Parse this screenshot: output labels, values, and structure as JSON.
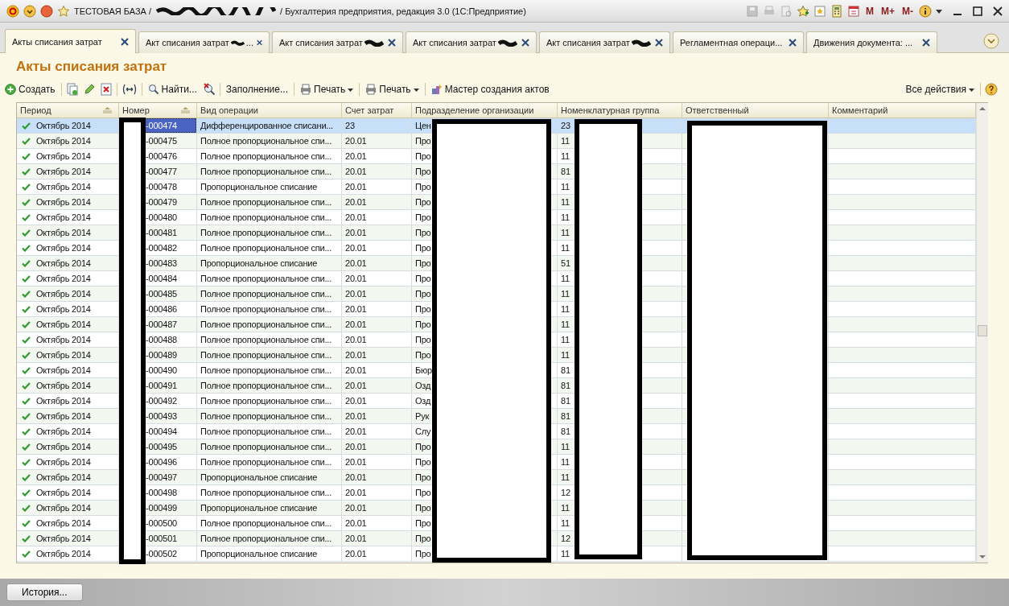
{
  "window": {
    "title_start": "ТЕСТОВАЯ БАЗА /",
    "title_end": "/ Бухгалтерия предприятия, редакция 3.0  (1С:Предприятие)",
    "memory_buttons": [
      "M",
      "M+",
      "M-"
    ]
  },
  "tabs": [
    {
      "label": "Акты списания затрат",
      "redacted": false,
      "selected": true
    },
    {
      "label": "Акт списания затрат",
      "redacted": true,
      "tail": "...",
      "selected": false
    },
    {
      "label": "Акт списания затрат",
      "redacted": true,
      "selected": false
    },
    {
      "label": "Акт списания затрат",
      "redacted": true,
      "selected": false
    },
    {
      "label": "Акт списания затрат",
      "redacted": true,
      "selected": false
    },
    {
      "label": "Регламентная операци...",
      "redacted": false,
      "selected": false
    },
    {
      "label": "Движения документа: ...",
      "redacted": false,
      "selected": false
    }
  ],
  "page_title": "Акты списания затрат",
  "toolbar": [
    {
      "kind": "create",
      "label": "Создать"
    },
    {
      "kind": "copy"
    },
    {
      "kind": "edit"
    },
    {
      "kind": "delete"
    },
    {
      "kind": "interval"
    },
    {
      "kind": "find",
      "label": "Найти..."
    },
    {
      "kind": "clear-find"
    },
    {
      "kind": "text",
      "label": "Заполнение..."
    },
    {
      "kind": "print",
      "label": "Печать"
    },
    {
      "kind": "print",
      "label": "Печать"
    },
    {
      "kind": "wizard",
      "label": "Мастер создания актов"
    }
  ],
  "all_actions": "Все действия",
  "table": {
    "columns": [
      {
        "label": "Период",
        "sortable": true
      },
      {
        "label": "Номер",
        "sortable": true
      },
      {
        "label": "Вид операции",
        "sortable": false
      },
      {
        "label": "Счет затрат",
        "sortable": false
      },
      {
        "label": "Подразделение организации",
        "sortable": false
      },
      {
        "label": "Номенклатурная группа",
        "sortable": false
      },
      {
        "label": "Ответственный",
        "sortable": false
      },
      {
        "label": "Комментарий",
        "sortable": false
      }
    ],
    "rows": [
      {
        "posted": true,
        "selected": true,
        "period": "Октябрь 2014",
        "number": "-000474",
        "operation": "Дифференцированное списани...",
        "account": "23",
        "division": "Цен",
        "group": "23"
      },
      {
        "posted": true,
        "selected": false,
        "period": "Октябрь 2014",
        "number": "-000475",
        "operation": "Полное пропорциональное спи...",
        "account": "20.01",
        "division": "Про",
        "group": "11"
      },
      {
        "posted": true,
        "selected": false,
        "period": "Октябрь 2014",
        "number": "-000476",
        "operation": "Полное пропорциональное спи...",
        "account": "20.01",
        "division": "Про",
        "group": "11"
      },
      {
        "posted": true,
        "selected": false,
        "period": "Октябрь 2014",
        "number": "-000477",
        "operation": "Полное пропорциональное спи...",
        "account": "20.01",
        "division": "Про",
        "group": "81"
      },
      {
        "posted": true,
        "selected": false,
        "period": "Октябрь 2014",
        "number": "-000478",
        "operation": "Пропорциональное списание",
        "account": "20.01",
        "division": "Про",
        "group": "11"
      },
      {
        "posted": true,
        "selected": false,
        "period": "Октябрь 2014",
        "number": "-000479",
        "operation": "Полное пропорциональное спи...",
        "account": "20.01",
        "division": "Про",
        "group": "11"
      },
      {
        "posted": true,
        "selected": false,
        "period": "Октябрь 2014",
        "number": "-000480",
        "operation": "Полное пропорциональное спи...",
        "account": "20.01",
        "division": "Про",
        "group": "11"
      },
      {
        "posted": true,
        "selected": false,
        "period": "Октябрь 2014",
        "number": "-000481",
        "operation": "Полное пропорциональное спи...",
        "account": "20.01",
        "division": "Про",
        "group": "11"
      },
      {
        "posted": true,
        "selected": false,
        "period": "Октябрь 2014",
        "number": "-000482",
        "operation": "Полное пропорциональное спи...",
        "account": "20.01",
        "division": "Про",
        "group": "11"
      },
      {
        "posted": true,
        "selected": false,
        "period": "Октябрь 2014",
        "number": "-000483",
        "operation": "Пропорциональное списание",
        "account": "20.01",
        "division": "Про",
        "group": "51"
      },
      {
        "posted": true,
        "selected": false,
        "period": "Октябрь 2014",
        "number": "-000484",
        "operation": "Полное пропорциональное спи...",
        "account": "20.01",
        "division": "Про",
        "group": "11"
      },
      {
        "posted": true,
        "selected": false,
        "period": "Октябрь 2014",
        "number": "-000485",
        "operation": "Полное пропорциональное спи...",
        "account": "20.01",
        "division": "Про",
        "group": "11"
      },
      {
        "posted": true,
        "selected": false,
        "period": "Октябрь 2014",
        "number": "-000486",
        "operation": "Полное пропорциональное спи...",
        "account": "20.01",
        "division": "Про",
        "group": "11"
      },
      {
        "posted": true,
        "selected": false,
        "period": "Октябрь 2014",
        "number": "-000487",
        "operation": "Полное пропорциональное спи...",
        "account": "20.01",
        "division": "Про",
        "group": "11"
      },
      {
        "posted": true,
        "selected": false,
        "period": "Октябрь 2014",
        "number": "-000488",
        "operation": "Полное пропорциональное спи...",
        "account": "20.01",
        "division": "Про",
        "group": "11"
      },
      {
        "posted": true,
        "selected": false,
        "period": "Октябрь 2014",
        "number": "-000489",
        "operation": "Полное пропорциональное спи...",
        "account": "20.01",
        "division": "Про",
        "group": "11"
      },
      {
        "posted": true,
        "selected": false,
        "period": "Октябрь 2014",
        "number": "-000490",
        "operation": "Полное пропорциональное спи...",
        "account": "20.01",
        "division": "Бюр",
        "group": "81"
      },
      {
        "posted": true,
        "selected": false,
        "period": "Октябрь 2014",
        "number": "-000491",
        "operation": "Полное пропорциональное спи...",
        "account": "20.01",
        "division": "Озд",
        "group": "81"
      },
      {
        "posted": true,
        "selected": false,
        "period": "Октябрь 2014",
        "number": "-000492",
        "operation": "Полное пропорциональное спи...",
        "account": "20.01",
        "division": "Озд",
        "group": "81"
      },
      {
        "posted": true,
        "selected": false,
        "period": "Октябрь 2014",
        "number": "-000493",
        "operation": "Полное пропорциональное спи...",
        "account": "20.01",
        "division": "Рук",
        "group": "81"
      },
      {
        "posted": true,
        "selected": false,
        "period": "Октябрь 2014",
        "number": "-000494",
        "operation": "Полное пропорциональное спи...",
        "account": "20.01",
        "division": "Слу",
        "group": "81"
      },
      {
        "posted": true,
        "selected": false,
        "period": "Октябрь 2014",
        "number": "-000495",
        "operation": "Полное пропорциональное спи...",
        "account": "20.01",
        "division": "Про",
        "group": "11"
      },
      {
        "posted": true,
        "selected": false,
        "period": "Октябрь 2014",
        "number": "-000496",
        "operation": "Полное пропорциональное спи...",
        "account": "20.01",
        "division": "Про",
        "group": "11"
      },
      {
        "posted": true,
        "selected": false,
        "period": "Октябрь 2014",
        "number": "-000497",
        "operation": "Пропорциональное списание",
        "account": "20.01",
        "division": "Про",
        "group": "11"
      },
      {
        "posted": true,
        "selected": false,
        "period": "Октябрь 2014",
        "number": "-000498",
        "operation": "Полное пропорциональное спи...",
        "account": "20.01",
        "division": "Про",
        "group": "12"
      },
      {
        "posted": true,
        "selected": false,
        "period": "Октябрь 2014",
        "number": "-000499",
        "operation": "Пропорциональное списание",
        "account": "20.01",
        "division": "Про",
        "group": "11"
      },
      {
        "posted": true,
        "selected": false,
        "period": "Октябрь 2014",
        "number": "-000500",
        "operation": "Полное пропорциональное спи...",
        "account": "20.01",
        "division": "Про",
        "group": "11"
      },
      {
        "posted": true,
        "selected": false,
        "period": "Октябрь 2014",
        "number": "-000501",
        "operation": "Полное пропорциональное спи...",
        "account": "20.01",
        "division": "Про",
        "group": "12"
      },
      {
        "posted": true,
        "selected": false,
        "period": "Октябрь 2014",
        "number": "-000502",
        "operation": "Пропорциональное списание",
        "account": "20.01",
        "division": "Про",
        "group": "11"
      }
    ]
  },
  "history_button": "История..."
}
